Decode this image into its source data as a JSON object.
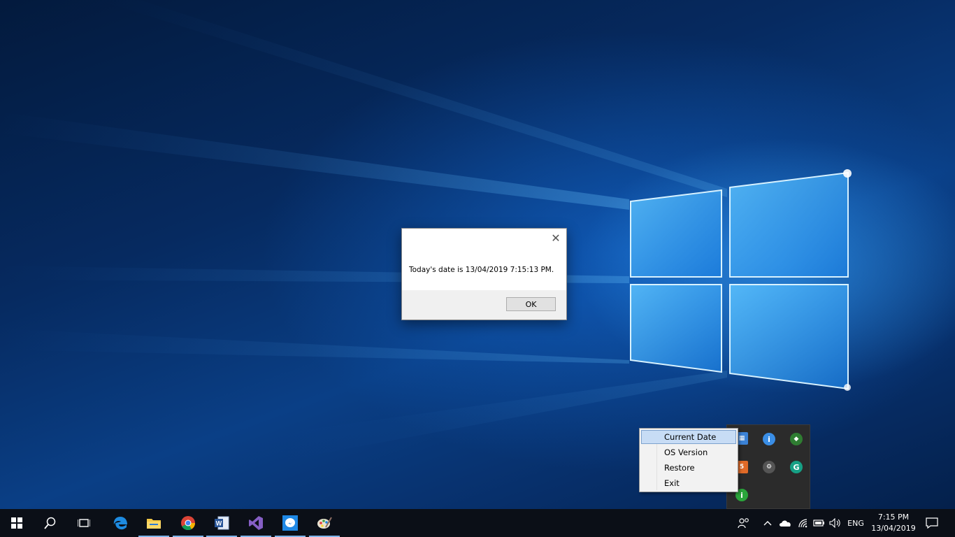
{
  "dialog": {
    "message": "Today's date is 13/04/2019 7:15:13 PM.",
    "ok_label": "OK",
    "close_glyph": "✕"
  },
  "context_menu": {
    "items": [
      {
        "label": "Current Date",
        "highlighted": true
      },
      {
        "label": "OS Version"
      },
      {
        "label": "Restore"
      },
      {
        "label": "Exit"
      }
    ]
  },
  "taskbar": {
    "pinned": [
      {
        "name": "start-icon"
      },
      {
        "name": "search-icon"
      },
      {
        "name": "task-view-icon"
      },
      {
        "name": "edge-icon"
      },
      {
        "name": "file-explorer-icon",
        "active": true
      },
      {
        "name": "chrome-icon",
        "active": true
      },
      {
        "name": "word-icon",
        "active": true
      },
      {
        "name": "visual-studio-icon",
        "active": true
      },
      {
        "name": "messenger-icon",
        "active": true
      },
      {
        "name": "paint-icon",
        "active": true
      }
    ],
    "language": "ENG",
    "time": "7:15 PM",
    "date": "13/04/2019"
  },
  "colors": {
    "taskbar": "#0b0f17",
    "menu_highlight": "#c7dcf5",
    "accent": "#7eb4ea"
  }
}
